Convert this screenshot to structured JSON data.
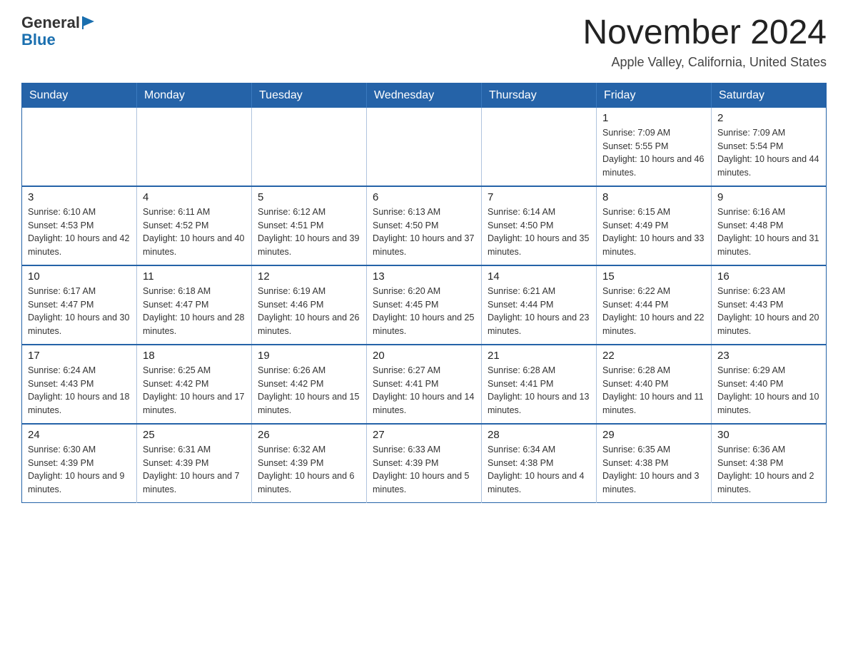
{
  "header": {
    "logo_general": "General",
    "logo_blue": "Blue",
    "month_title": "November 2024",
    "location": "Apple Valley, California, United States"
  },
  "days_of_week": [
    "Sunday",
    "Monday",
    "Tuesday",
    "Wednesday",
    "Thursday",
    "Friday",
    "Saturday"
  ],
  "weeks": [
    [
      {
        "day": "",
        "info": ""
      },
      {
        "day": "",
        "info": ""
      },
      {
        "day": "",
        "info": ""
      },
      {
        "day": "",
        "info": ""
      },
      {
        "day": "",
        "info": ""
      },
      {
        "day": "1",
        "info": "Sunrise: 7:09 AM\nSunset: 5:55 PM\nDaylight: 10 hours and 46 minutes."
      },
      {
        "day": "2",
        "info": "Sunrise: 7:09 AM\nSunset: 5:54 PM\nDaylight: 10 hours and 44 minutes."
      }
    ],
    [
      {
        "day": "3",
        "info": "Sunrise: 6:10 AM\nSunset: 4:53 PM\nDaylight: 10 hours and 42 minutes."
      },
      {
        "day": "4",
        "info": "Sunrise: 6:11 AM\nSunset: 4:52 PM\nDaylight: 10 hours and 40 minutes."
      },
      {
        "day": "5",
        "info": "Sunrise: 6:12 AM\nSunset: 4:51 PM\nDaylight: 10 hours and 39 minutes."
      },
      {
        "day": "6",
        "info": "Sunrise: 6:13 AM\nSunset: 4:50 PM\nDaylight: 10 hours and 37 minutes."
      },
      {
        "day": "7",
        "info": "Sunrise: 6:14 AM\nSunset: 4:50 PM\nDaylight: 10 hours and 35 minutes."
      },
      {
        "day": "8",
        "info": "Sunrise: 6:15 AM\nSunset: 4:49 PM\nDaylight: 10 hours and 33 minutes."
      },
      {
        "day": "9",
        "info": "Sunrise: 6:16 AM\nSunset: 4:48 PM\nDaylight: 10 hours and 31 minutes."
      }
    ],
    [
      {
        "day": "10",
        "info": "Sunrise: 6:17 AM\nSunset: 4:47 PM\nDaylight: 10 hours and 30 minutes."
      },
      {
        "day": "11",
        "info": "Sunrise: 6:18 AM\nSunset: 4:47 PM\nDaylight: 10 hours and 28 minutes."
      },
      {
        "day": "12",
        "info": "Sunrise: 6:19 AM\nSunset: 4:46 PM\nDaylight: 10 hours and 26 minutes."
      },
      {
        "day": "13",
        "info": "Sunrise: 6:20 AM\nSunset: 4:45 PM\nDaylight: 10 hours and 25 minutes."
      },
      {
        "day": "14",
        "info": "Sunrise: 6:21 AM\nSunset: 4:44 PM\nDaylight: 10 hours and 23 minutes."
      },
      {
        "day": "15",
        "info": "Sunrise: 6:22 AM\nSunset: 4:44 PM\nDaylight: 10 hours and 22 minutes."
      },
      {
        "day": "16",
        "info": "Sunrise: 6:23 AM\nSunset: 4:43 PM\nDaylight: 10 hours and 20 minutes."
      }
    ],
    [
      {
        "day": "17",
        "info": "Sunrise: 6:24 AM\nSunset: 4:43 PM\nDaylight: 10 hours and 18 minutes."
      },
      {
        "day": "18",
        "info": "Sunrise: 6:25 AM\nSunset: 4:42 PM\nDaylight: 10 hours and 17 minutes."
      },
      {
        "day": "19",
        "info": "Sunrise: 6:26 AM\nSunset: 4:42 PM\nDaylight: 10 hours and 15 minutes."
      },
      {
        "day": "20",
        "info": "Sunrise: 6:27 AM\nSunset: 4:41 PM\nDaylight: 10 hours and 14 minutes."
      },
      {
        "day": "21",
        "info": "Sunrise: 6:28 AM\nSunset: 4:41 PM\nDaylight: 10 hours and 13 minutes."
      },
      {
        "day": "22",
        "info": "Sunrise: 6:28 AM\nSunset: 4:40 PM\nDaylight: 10 hours and 11 minutes."
      },
      {
        "day": "23",
        "info": "Sunrise: 6:29 AM\nSunset: 4:40 PM\nDaylight: 10 hours and 10 minutes."
      }
    ],
    [
      {
        "day": "24",
        "info": "Sunrise: 6:30 AM\nSunset: 4:39 PM\nDaylight: 10 hours and 9 minutes."
      },
      {
        "day": "25",
        "info": "Sunrise: 6:31 AM\nSunset: 4:39 PM\nDaylight: 10 hours and 7 minutes."
      },
      {
        "day": "26",
        "info": "Sunrise: 6:32 AM\nSunset: 4:39 PM\nDaylight: 10 hours and 6 minutes."
      },
      {
        "day": "27",
        "info": "Sunrise: 6:33 AM\nSunset: 4:39 PM\nDaylight: 10 hours and 5 minutes."
      },
      {
        "day": "28",
        "info": "Sunrise: 6:34 AM\nSunset: 4:38 PM\nDaylight: 10 hours and 4 minutes."
      },
      {
        "day": "29",
        "info": "Sunrise: 6:35 AM\nSunset: 4:38 PM\nDaylight: 10 hours and 3 minutes."
      },
      {
        "day": "30",
        "info": "Sunrise: 6:36 AM\nSunset: 4:38 PM\nDaylight: 10 hours and 2 minutes."
      }
    ]
  ]
}
